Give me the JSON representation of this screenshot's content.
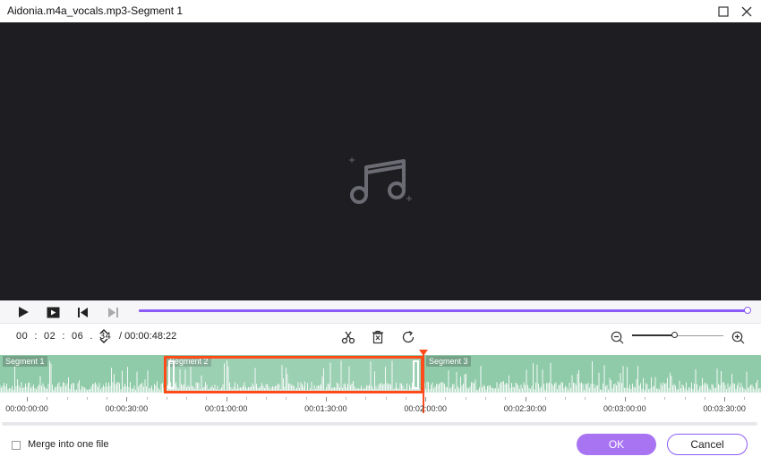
{
  "window": {
    "title": "Aidonia.m4a_vocals.mp3-Segment 1",
    "icons": [
      "maximize-icon",
      "close-icon"
    ]
  },
  "preview": {
    "icon": "music-note-icon"
  },
  "playback": {
    "icons": [
      "play-icon",
      "play-clip-icon",
      "skip-back-icon",
      "skip-forward-icon"
    ],
    "progress_fraction": 1.0,
    "accent_color": "#8b5cf6"
  },
  "controls": {
    "current_time": "00  :  02  :  06  .  34",
    "duration": "/ 00:00:48:22",
    "icons": [
      "scissors-icon",
      "delete-icon",
      "reset-icon",
      "zoom-out-icon",
      "zoom-in-icon"
    ],
    "zoom_fraction": 0.47
  },
  "timeline": {
    "segments": [
      "Segment 1",
      "Segment 2",
      "Segment 3"
    ],
    "ruler_labels": [
      "00:00:00:00",
      "00:00:30:00",
      "00:01:00:00",
      "00:01:30:00",
      "00:02:00:00",
      "00:02:30:00",
      "00:03:00:00",
      "00:03:30:00"
    ],
    "wave_color": "#8fcaa9",
    "selection_color": "#ff4a1a"
  },
  "footer": {
    "merge_label": "Merge into one file",
    "merge_checked": false,
    "ok_label": "OK",
    "cancel_label": "Cancel"
  }
}
